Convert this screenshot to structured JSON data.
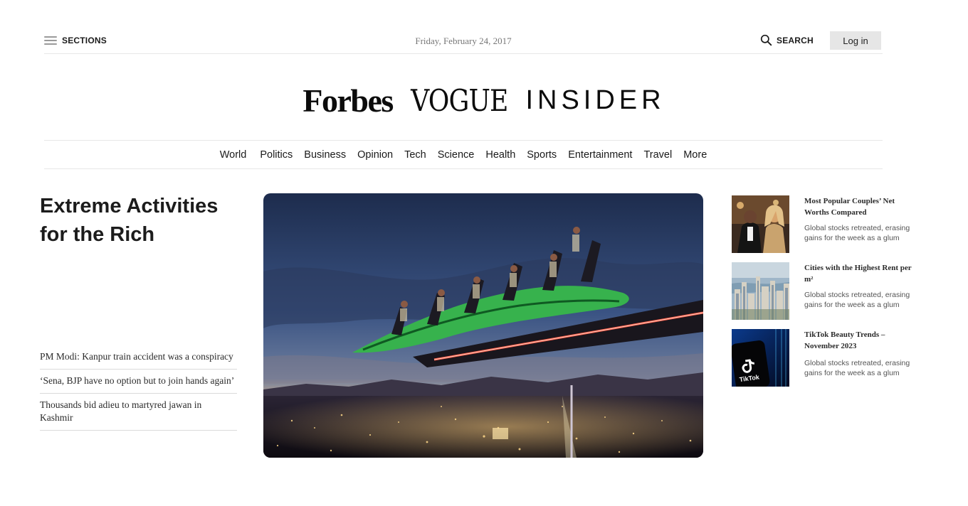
{
  "topbar": {
    "sections_label": "SECTIONS",
    "date": "Friday, February 24, 2017",
    "search_label": "SEARCH",
    "login_label": "Log in"
  },
  "masthead": {
    "logos": [
      "Forbes",
      "VOGUE",
      "INSIDER"
    ]
  },
  "nav": {
    "items": [
      "World",
      "Politics",
      "Business",
      "Opinion",
      "Tech",
      "Science",
      "Health",
      "Sports",
      "Entertainment",
      "Travel",
      "More"
    ]
  },
  "main": {
    "headline": "Extreme Activities for the Rich",
    "headlines": [
      "PM Modi: Kanpur train accident was a conspiracy",
      "‘Sena, BJP have no option but to join hands again’",
      "Thousands bid adieu to martyred jawan in Kashmir"
    ]
  },
  "sidebar": {
    "items": [
      {
        "title": "Most Popular Couples’ Net Worths Compared",
        "desc": "Global stocks retreated, erasing gains for the week as a glum"
      },
      {
        "title": "Cities with the Highest Rent per m²",
        "desc": "Global stocks retreated, erasing gains for the week as a glum"
      },
      {
        "title": "TikTok Beauty Trends – November 2023",
        "desc": "Global stocks retreated, erasing gains for the week as a glum",
        "thumb_text": "TikTok"
      }
    ]
  },
  "colors": {
    "divider": "#e7e7e7",
    "login_bg": "#e6e6e6",
    "text_dark": "#1a1a1a",
    "date_text": "#777777"
  },
  "icons": {
    "menu": "hamburger-icon",
    "search": "search-icon"
  }
}
